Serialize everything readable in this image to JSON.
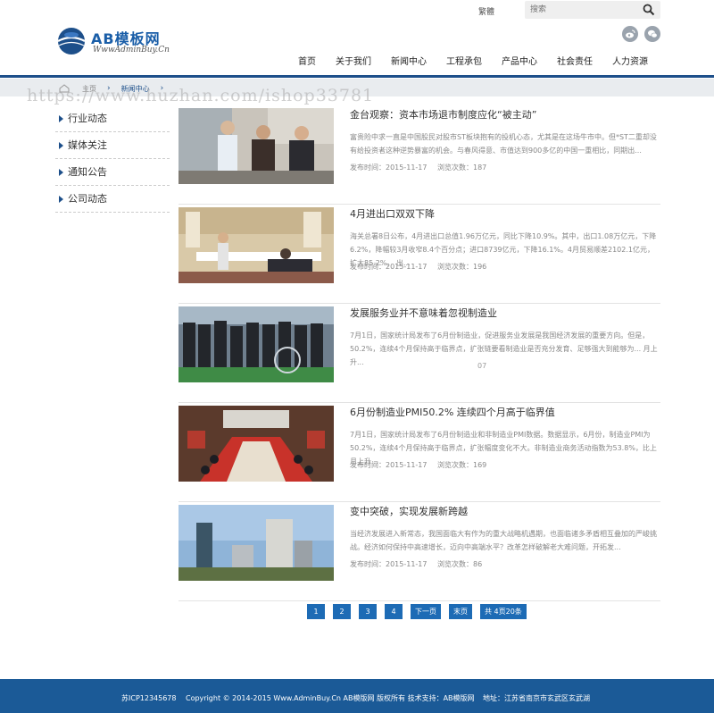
{
  "header": {
    "lang_label": "繁體",
    "search_placeholder": "搜索",
    "logo_brand": "AB模板网",
    "logo_url": "WwwAdminBuy.Cn",
    "nav": [
      "首页",
      "关于我们",
      "新闻中心",
      "工程承包",
      "产品中心",
      "社会责任",
      "人力资源"
    ]
  },
  "breadcrumb": {
    "home": "主页",
    "current": "新闻中心"
  },
  "watermark": "https://www.huzhan.com/ishop33781",
  "sidebar": [
    "行业动态",
    "媒体关注",
    "通知公告",
    "公司动态"
  ],
  "news": [
    {
      "title": "金台观察：资本市场退市制度应化“被主动”",
      "summary": "富贵险中求一直是中国股民对股市ST板块抱有的投机心态，尤其是在这场牛市中。但*ST二重却没有给投资者这种逆势暴富的机会。与春风得意、市值达到900多亿的中国一重相比，同期出...",
      "date": "发布时间：2015-11-17",
      "views": "浏览次数：187",
      "extra": ""
    },
    {
      "title": "4月进出口双双下降",
      "summary": "海关总署8日公布，4月进出口总值1.96万亿元，同比下降10.9%。其中，出口1.08万亿元，下降6.2%，降幅较3月收窄8.4个百分点；进口8739亿元，下降16.1%。4月贸易顺差2102.1亿元，扩大85.2%。 出...",
      "date": "发布时间：2015-11-17",
      "views": "浏览次数：196",
      "extra": ""
    },
    {
      "title": "发展服务业并不意味着忽视制造业",
      "summary": "7月1日，国家统计局发布了6月份制造业，促进服务业发展是我国经济发展的重要方向。但是，50.2%，连续4个月保持高于临界点，扩张链要看制造业是否充分发育、足够强大到能够为... 月上升...",
      "date": "",
      "views": "",
      "extra": "07"
    },
    {
      "title": "6月份制造业PMI50.2% 连续四个月高于临界值",
      "summary": "7月1日，国家统计局发布了6月份制造业和非制造业PMI数据。数据显示，6月份，制造业PMI为50.2%，连续4个月保持高于临界点，扩张幅度变化不大。非制造业商务活动指数为53.8%，比上月上升...",
      "date": "发布时间：2015-11-17",
      "views": "浏览次数：169",
      "extra": ""
    },
    {
      "title": "变中突破，实现发展新跨越",
      "summary": "当经济发展进入新常态，我国面临大有作为的重大战略机遇期，也面临诸多矛盾相互叠加的严峻挑战。经济如何保持中高速增长，迈向中高端水平？改革怎样破解老大难问题，开拓发...",
      "date": "发布时间：2015-11-17",
      "views": "浏览次数：86",
      "extra": ""
    }
  ],
  "pager": [
    "1",
    "2",
    "3",
    "4",
    "下一页",
    "末页",
    "共 4页20条"
  ],
  "footer": {
    "icp": "苏ICP12345678",
    "copyright": "Copyright © 2014-2015 Www.AdminBuy.Cn AB模版网 版权所有 技术支持：AB模版网",
    "address": "地址：江苏省南京市玄武区玄武湖"
  }
}
